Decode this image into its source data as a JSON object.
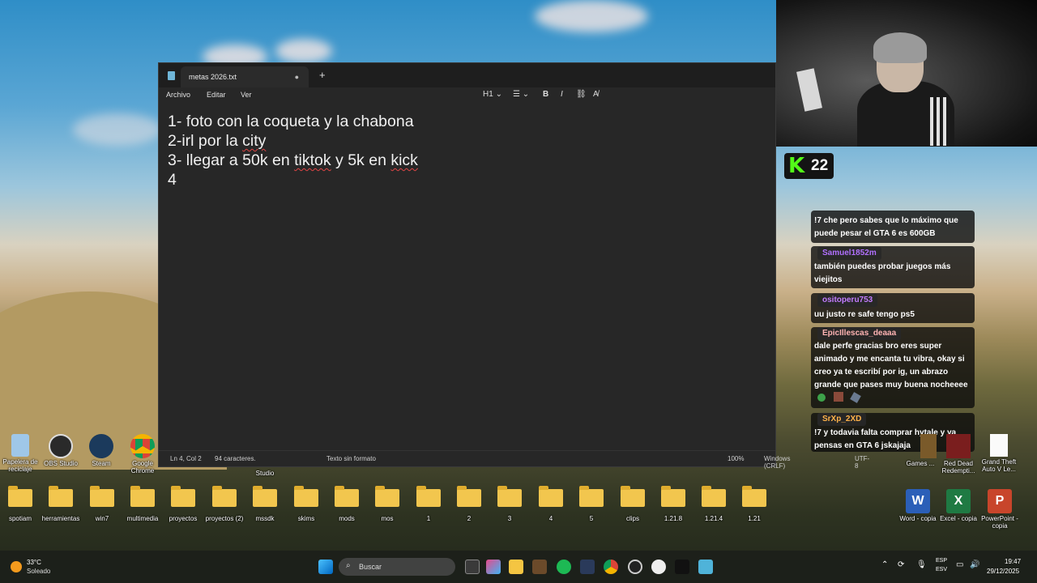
{
  "notepad": {
    "tab_title": "metas 2026.txt",
    "menu": [
      "Archivo",
      "Editar",
      "Ver"
    ],
    "heading_tool": "H1",
    "lines": [
      "1- foto con la coqueta y la chabona",
      "2-irl por la city",
      "3- llegar a 50k en tiktok y 5k en kick",
      "4"
    ],
    "status": {
      "position": "Ln 4, Col 2",
      "chars": "94 caracteres.",
      "format": "Texto sin formato",
      "zoom": "100%",
      "eol": "Windows (CRLF)",
      "encoding": "UTF-8"
    }
  },
  "kick": {
    "viewers": "22",
    "brand_color": "#53fc18"
  },
  "chat": [
    {
      "user": "",
      "color": "#b070ff",
      "text": "!7 che pero sabes que lo máximo que puede pesar el GTA 6 es 600GB"
    },
    {
      "user": "Samuel1852m",
      "color": "#b070ff",
      "text": "también puedes probar juegos más viejitos"
    },
    {
      "user": "ositoperu753",
      "color": "#c27bff",
      "text": "uu justo re safe tengo ps5"
    },
    {
      "user": "EpicIllescas_deaaa",
      "color": "#ffb3b3",
      "text": "dale perfe gracias bro eres super animado y me encanta tu vibra, okay si creo ya te escribí por ig, un abrazo grande que pases muy buena nocheeee"
    },
    {
      "user": "SrXp_2XD",
      "color": "#ffb24a",
      "text": "!7 y todavia falta comprar hytale y ya pensas en GTA 6 jskajaja"
    }
  ],
  "desktop_top_icons": [
    {
      "label": "Papelera de\nreciclaje",
      "icon": "recycle-bin-icon"
    },
    {
      "label": "OBS Studio",
      "icon": "obs-icon"
    },
    {
      "label": "Steam",
      "icon": "steam-icon"
    },
    {
      "label": "Google\nChrome",
      "icon": "chrome-icon"
    }
  ],
  "desktop_partial_label": "Studio",
  "desktop_right_icons": [
    {
      "label": "Games ...",
      "icon": "games-icon"
    },
    {
      "label": "Red Dead\nRedempti...",
      "icon": "rdr-icon"
    },
    {
      "label": "Grand Theft\nAuto V Le...",
      "icon": "document-icon"
    }
  ],
  "desktop_folders": [
    "spotiam",
    "herramientas",
    "win7",
    "multimedia",
    "proyectos",
    "proyectos (2)",
    "mssdk",
    "skims",
    "mods",
    "mos",
    "1",
    "2",
    "3",
    "4",
    "5",
    "clips",
    "1.21.8",
    "1.21.4",
    "1.21"
  ],
  "office_icons": [
    {
      "label": "Word - copia",
      "color": "#2b5fb8"
    },
    {
      "label": "Excel - copia",
      "color": "#1f7a43"
    },
    {
      "label": "PowerPoint -\ncopia",
      "color": "#c8452b"
    }
  ],
  "taskbar": {
    "weather_temp": "33°C",
    "weather_desc": "Soleado",
    "search_placeholder": "Buscar",
    "lang_top": "ESP",
    "lang_bottom": "ESV",
    "time": "19:47",
    "date": "29/12/2025"
  }
}
